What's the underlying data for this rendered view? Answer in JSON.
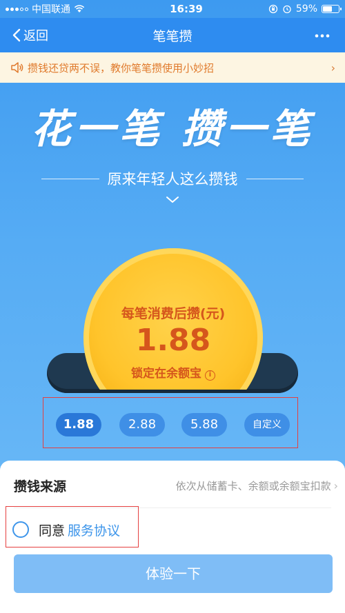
{
  "status_bar": {
    "carrier": "中国联通",
    "time": "16:39",
    "battery_text": "59%",
    "battery_level": 0.59
  },
  "nav": {
    "back_label": "返回",
    "title": "笔笔攒",
    "more_icon": "more-dots-icon"
  },
  "notice": {
    "text": "攒钱还贷两不误，教你笔笔攒使用小妙招",
    "icon": "speaker-icon",
    "arrow": "›"
  },
  "hero": {
    "title": "花一笔 攒一笔",
    "subtitle": "原来年轻人这么攒钱"
  },
  "coin": {
    "label_top": "每笔消费后攒(元)",
    "amount": "1.88",
    "label_bottom": "锁定在余额宝",
    "info_glyph": "i"
  },
  "amount_options": [
    {
      "label": "1.88",
      "selected": true
    },
    {
      "label": "2.88",
      "selected": false
    },
    {
      "label": "5.88",
      "selected": false
    },
    {
      "label": "自定义",
      "selected": false
    }
  ],
  "sheet": {
    "source_label": "攒钱来源",
    "source_value": "依次从储蓄卡、余额或余额宝扣款",
    "source_chevron": "›",
    "agree_prefix": "同意",
    "agree_link": "服务协议",
    "cta_label": "体验一下"
  },
  "colors": {
    "nav_bg": "#2e8cf0",
    "accent": "#3d95ea",
    "coin": "#ffc42b",
    "coin_text": "#d5561c",
    "highlight_box": "#e53f3f",
    "notice_bg": "#fdf5e2",
    "notice_text": "#e07a2c"
  }
}
